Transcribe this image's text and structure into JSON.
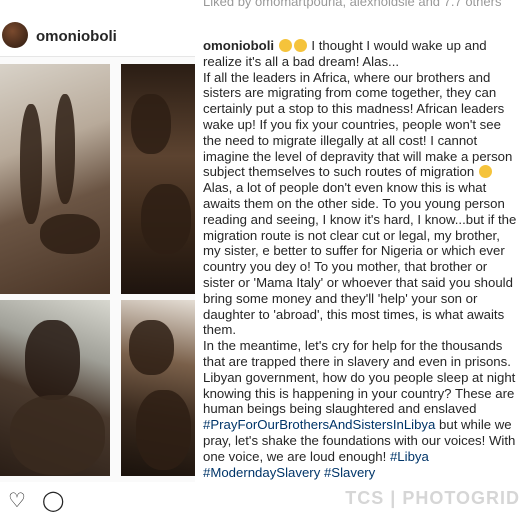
{
  "header": {
    "username": "omonioboli"
  },
  "liked_by": "Liked by omomartpouria, alexholdsie and 7.7 others",
  "caption": {
    "username": "omonioboli",
    "p1": "I thought I would wake up and realize it's all a bad dream! Alas...",
    "p2": "If all the leaders in Africa, where our brothers and sisters are migrating from come together, they can certainly put a stop to this madness! African leaders wake up! If you fix your countries, people won't see the need to migrate illegally at all cost! I cannot imagine the level of depravity that will make a person subject themselves to such routes of migration",
    "p2b": "Alas, a lot of people don't even know this is what awaits them on the other side. To you young person reading and seeing, I know it's hard, I know...but if the migration route is not clear cut or legal, my brother, my sister, e better to suffer for Nigeria or which ever country you dey o! To you mother, that brother or sister or 'Mama Italy' or whoever that said you should bring some money and they'll 'help' your son or daughter to 'abroad', this most times, is what awaits them.",
    "p3": "In the meantime, let's cry for help for the thousands that are trapped there in slavery and even in prisons. Libyan government, how do you people sleep at night knowing this is happening in your country? These are human beings being slaughtered and enslaved",
    "tag1": "#PrayForOurBrothersAndSistersInLibya",
    "p3b": "but while we pray, let's shake the foundations with our voices! With one voice, we are loud enough!",
    "tag2": "#Libya",
    "tag3": "#ModerndaySlavery",
    "tag4": "#Slavery"
  },
  "watermark": "TCS | PHOTOGRID",
  "icons": [
    "heart-icon",
    "comment-icon"
  ]
}
